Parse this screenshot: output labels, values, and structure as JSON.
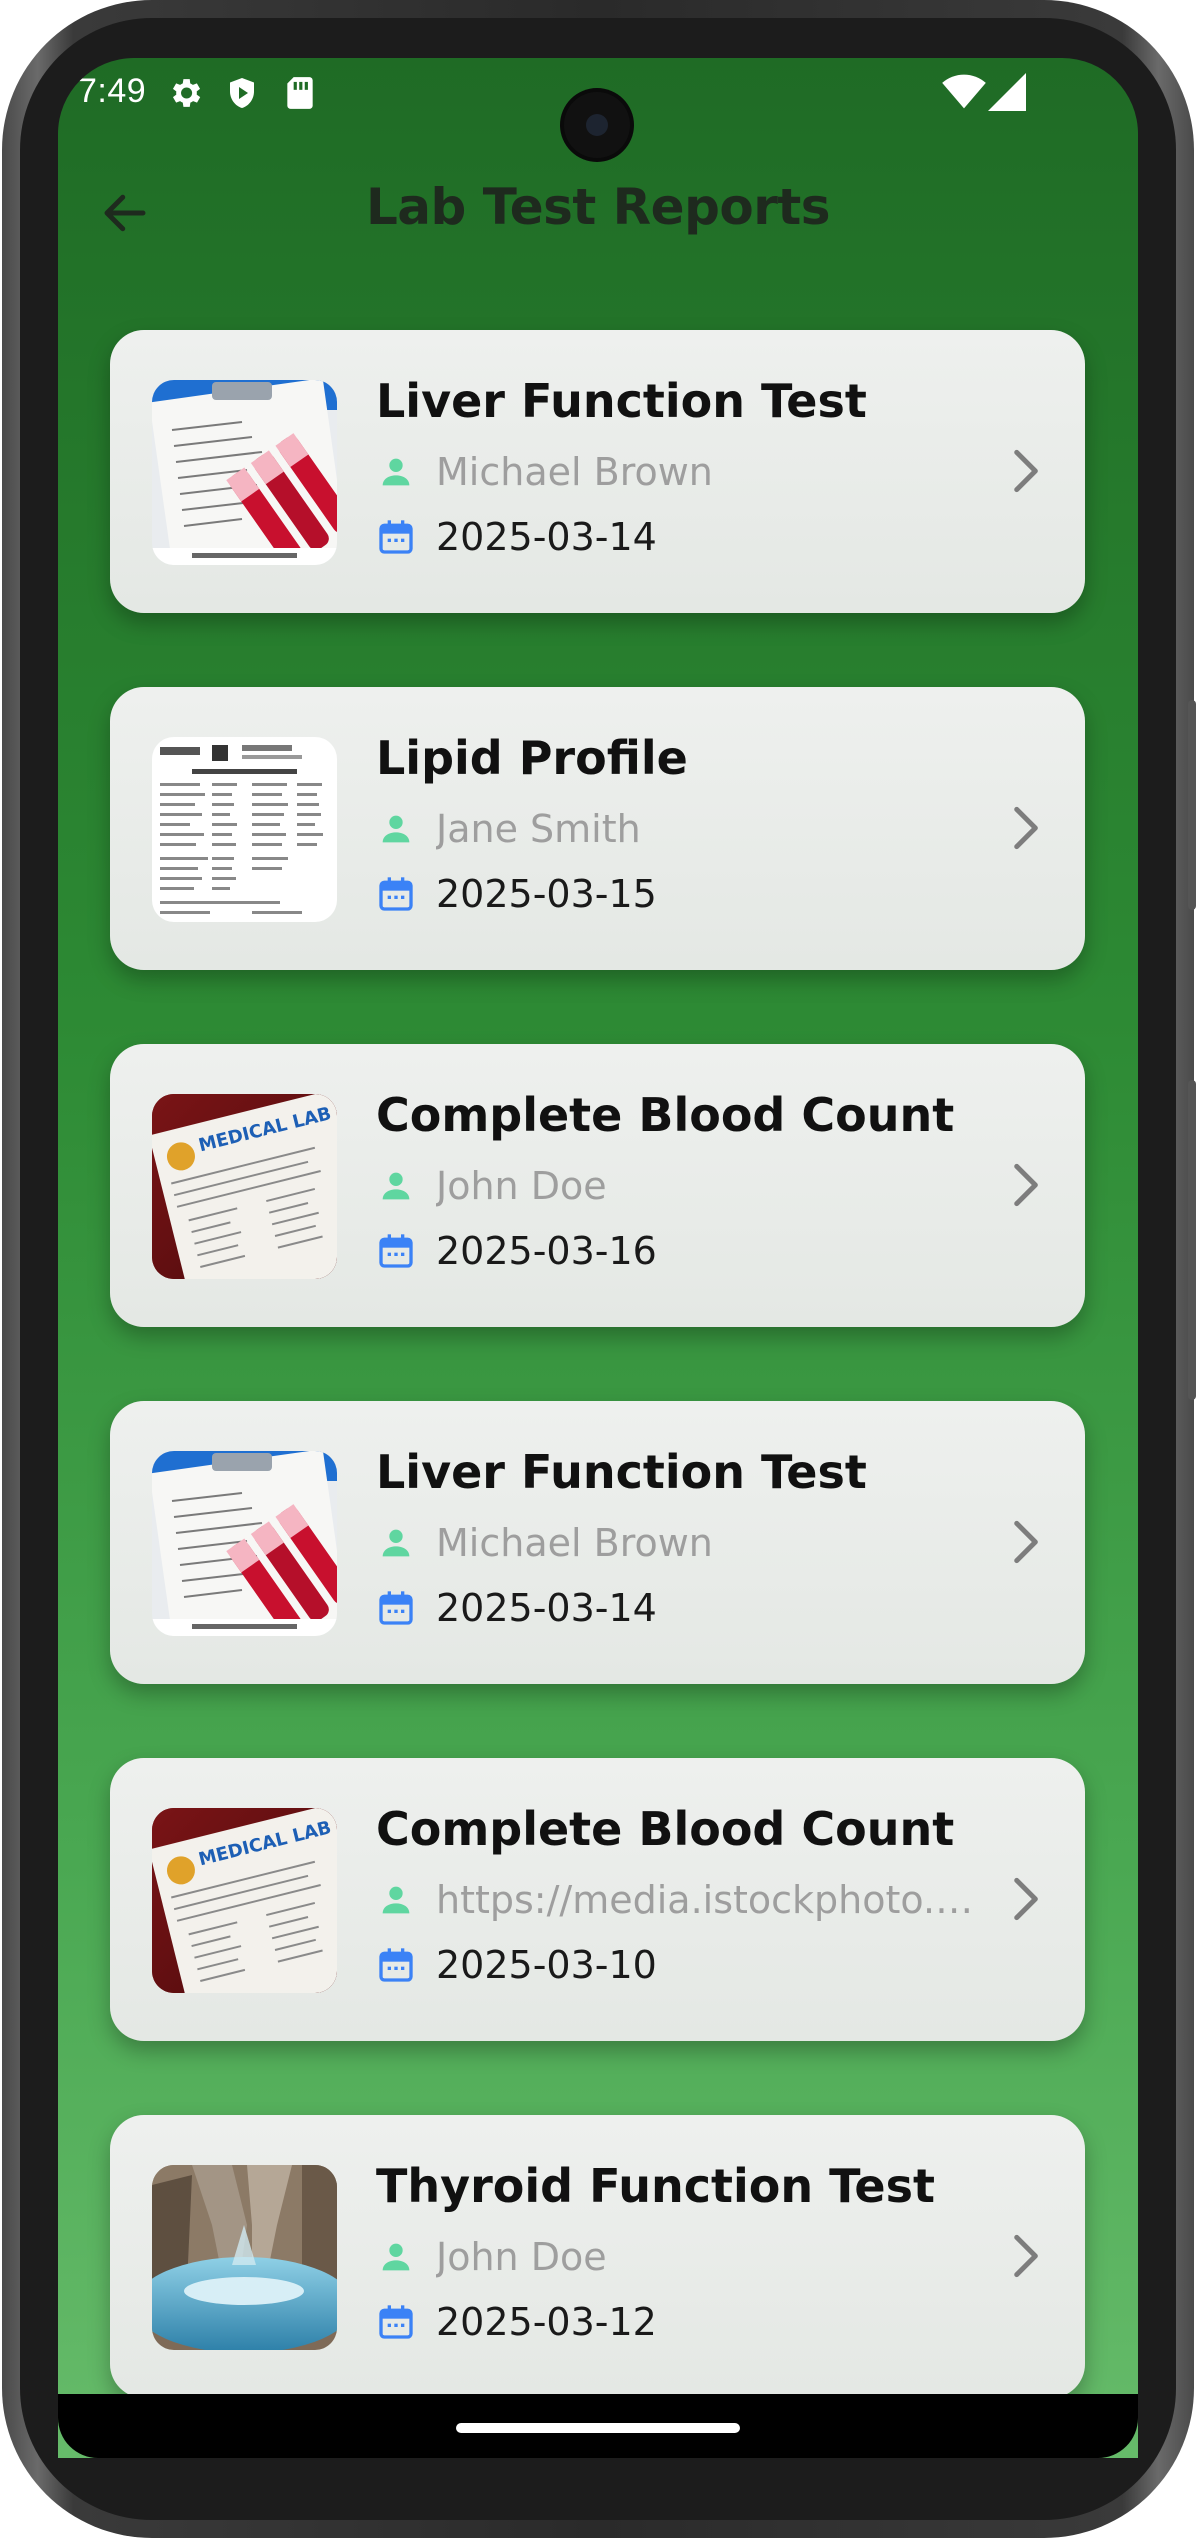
{
  "status_bar": {
    "time": "7:49",
    "icons": [
      "gear-icon",
      "shield-icon",
      "sd-card-icon",
      "wifi-icon",
      "signal-icon"
    ]
  },
  "header": {
    "title": "Lab Test Reports",
    "back_icon": "arrow-left-icon"
  },
  "colors": {
    "background_top": "#1f6b25",
    "background_bottom": "#66bb6a",
    "card": "#e8ebe8",
    "person_icon": "#5fd6a0",
    "calendar_icon": "#3b82f6",
    "secondary_text": "#9e9e9e"
  },
  "reports": [
    {
      "title": "Liver Function Test",
      "patient": "Michael Brown",
      "date": "2025-03-14",
      "thumbnail": "clipboard-blood-tubes"
    },
    {
      "title": "Lipid Profile",
      "patient": "Jane Smith",
      "date": "2025-03-15",
      "thumbnail": "report-sheet"
    },
    {
      "title": "Complete Blood Count",
      "patient": "John Doe",
      "date": "2025-03-16",
      "thumbnail": "medical-lab-test-form"
    },
    {
      "title": "Liver Function Test",
      "patient": "Michael Brown",
      "date": "2025-03-14",
      "thumbnail": "clipboard-blood-tubes"
    },
    {
      "title": "Complete Blood Count",
      "patient": "https://media.istockphoto.c...",
      "date": "2025-03-10",
      "thumbnail": "medical-lab-test-form"
    },
    {
      "title": "Thyroid Function Test",
      "patient": "John Doe",
      "date": "2025-03-12",
      "thumbnail": "fountain-photo"
    }
  ]
}
